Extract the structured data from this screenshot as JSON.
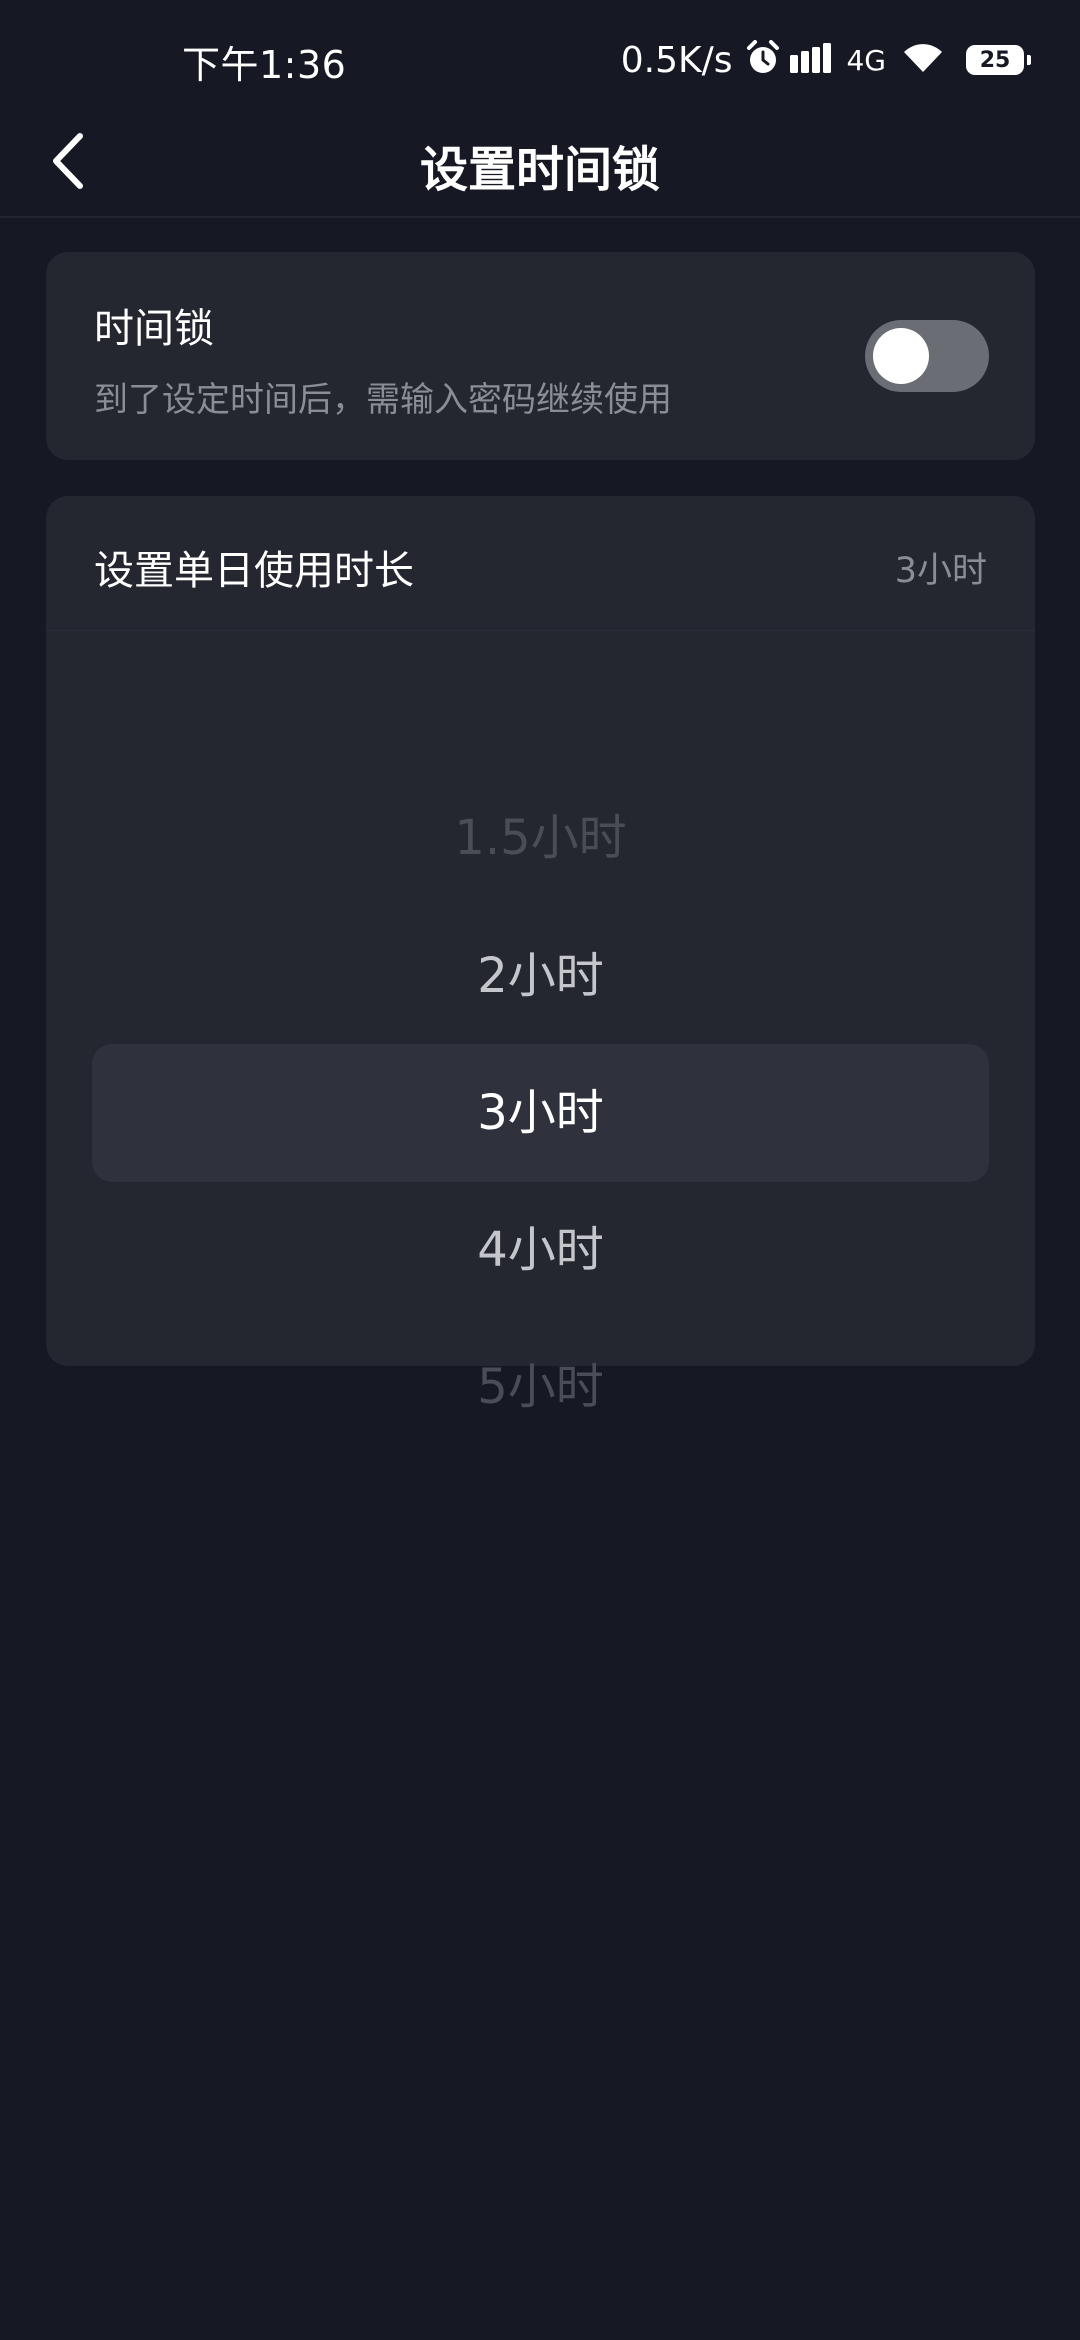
{
  "status_bar": {
    "time": "下午1:36",
    "net_speed": "0.5K/s",
    "network_type": "4G",
    "battery_level": "25",
    "icons": [
      "alarm-icon",
      "signal-icon",
      "wifi-icon",
      "battery-icon"
    ]
  },
  "nav": {
    "title": "设置时间锁",
    "back_icon": "chevron-left-icon"
  },
  "time_lock": {
    "title": "时间锁",
    "description": "到了设定时间后，需输入密码继续使用",
    "enabled": false
  },
  "duration": {
    "title": "设置单日使用时长",
    "current_value": "3小时",
    "options": [
      "1.5小时",
      "2小时",
      "3小时",
      "4小时",
      "5小时"
    ],
    "selected_index": 2
  },
  "colors": {
    "background": "#161823",
    "card": "#242630",
    "picker_highlight": "#2f313c",
    "secondary_text": "#8b8d96",
    "toggle_off": "#6b6d75"
  }
}
